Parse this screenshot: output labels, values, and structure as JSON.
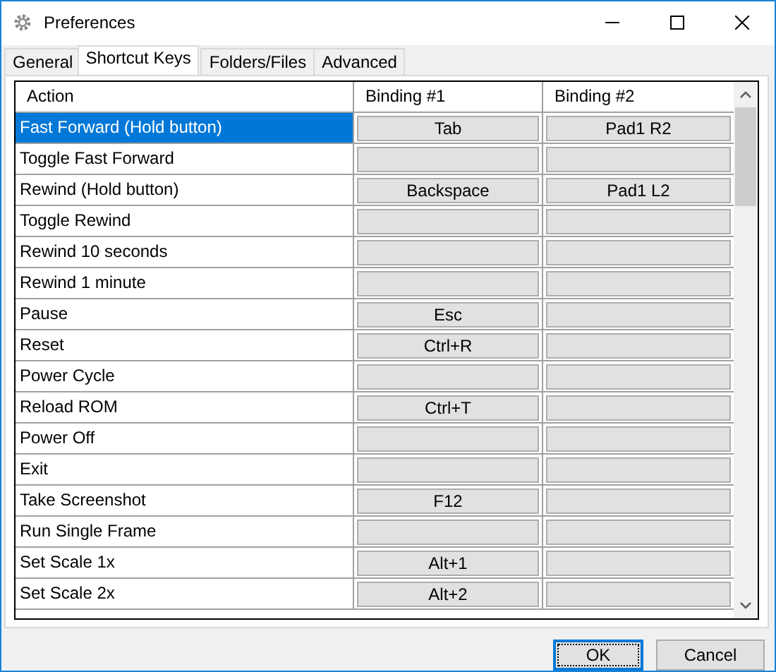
{
  "window": {
    "title": "Preferences"
  },
  "tabs": [
    {
      "label": "General",
      "selected": false
    },
    {
      "label": "Shortcut Keys",
      "selected": true
    },
    {
      "label": "Folders/Files",
      "selected": false
    },
    {
      "label": "Advanced",
      "selected": false
    }
  ],
  "table": {
    "columns": [
      "Action",
      "Binding #1",
      "Binding #2"
    ],
    "rows": [
      {
        "action": "Fast Forward (Hold button)",
        "binding_1": "Tab",
        "binding_2": "Pad1 R2",
        "selected": true
      },
      {
        "action": "Toggle Fast Forward",
        "binding_1": "",
        "binding_2": "",
        "selected": false
      },
      {
        "action": "Rewind (Hold button)",
        "binding_1": "Backspace",
        "binding_2": "Pad1 L2",
        "selected": false
      },
      {
        "action": "Toggle Rewind",
        "binding_1": "",
        "binding_2": "",
        "selected": false
      },
      {
        "action": "Rewind 10 seconds",
        "binding_1": "",
        "binding_2": "",
        "selected": false
      },
      {
        "action": "Rewind 1 minute",
        "binding_1": "",
        "binding_2": "",
        "selected": false
      },
      {
        "action": "Pause",
        "binding_1": "Esc",
        "binding_2": "",
        "selected": false
      },
      {
        "action": "Reset",
        "binding_1": "Ctrl+R",
        "binding_2": "",
        "selected": false
      },
      {
        "action": "Power Cycle",
        "binding_1": "",
        "binding_2": "",
        "selected": false
      },
      {
        "action": "Reload ROM",
        "binding_1": "Ctrl+T",
        "binding_2": "",
        "selected": false
      },
      {
        "action": "Power Off",
        "binding_1": "",
        "binding_2": "",
        "selected": false
      },
      {
        "action": "Exit",
        "binding_1": "",
        "binding_2": "",
        "selected": false
      },
      {
        "action": "Take Screenshot",
        "binding_1": "F12",
        "binding_2": "",
        "selected": false
      },
      {
        "action": "Run Single Frame",
        "binding_1": "",
        "binding_2": "",
        "selected": false
      },
      {
        "action": "Set Scale 1x",
        "binding_1": "Alt+1",
        "binding_2": "",
        "selected": false
      },
      {
        "action": "Set Scale 2x",
        "binding_1": "Alt+2",
        "binding_2": "",
        "selected": false
      }
    ]
  },
  "buttons": [
    {
      "label": "OK",
      "default": true
    },
    {
      "label": "Cancel",
      "default": false
    }
  ]
}
